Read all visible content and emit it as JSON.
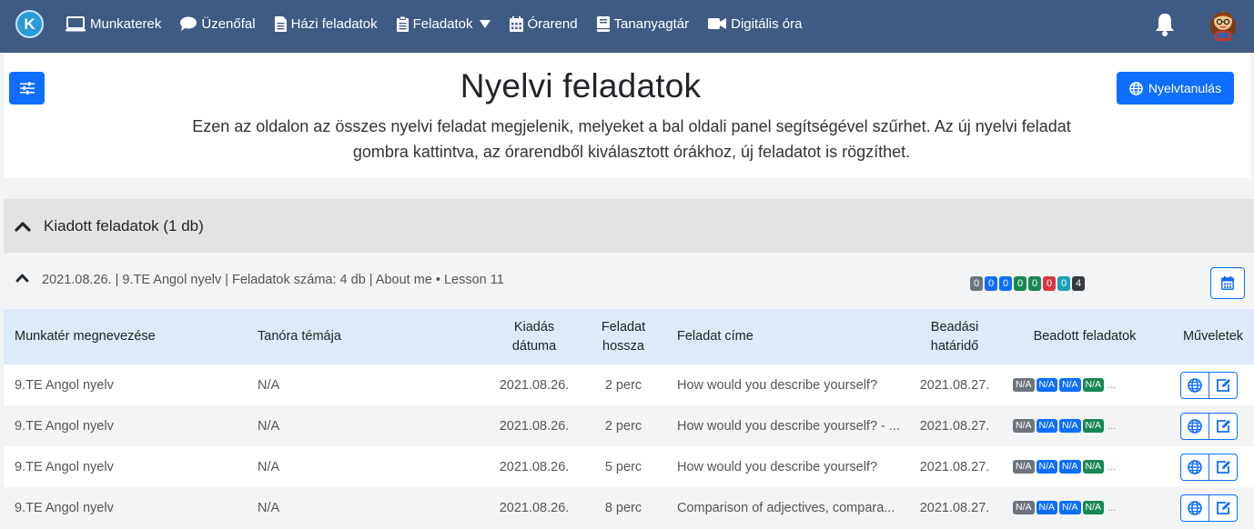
{
  "nav": {
    "logo_letter": "K",
    "items": [
      {
        "label": "Munkaterek",
        "icon": "laptop-icon"
      },
      {
        "label": "Üzenőfal",
        "icon": "chat-icon"
      },
      {
        "label": "Házi feladatok",
        "icon": "file-icon"
      },
      {
        "label": "Feladatok",
        "icon": "clipboard-icon"
      },
      {
        "label": "Órarend",
        "icon": "calendar-icon"
      },
      {
        "label": "Tananyagtár",
        "icon": "book-icon"
      },
      {
        "label": "Digitális óra",
        "icon": "video-icon"
      }
    ]
  },
  "header": {
    "title": "Nyelvi feladatok",
    "language_button": "Nyelvtanulás",
    "description": "Ezen az oldalon az összes nyelvi feladat megjelenik, melyeket a bal oldali panel segítségével szűrhet. Az új nyelvi feladat gombra kattintva, az órarendből kiválasztott órákhoz, új feladatot is rögzíthet."
  },
  "section": {
    "title": "Kiadott feladatok (1 db)"
  },
  "group": {
    "summary": "2021.08.26. | 9.TE Angol nyelv | Feladatok száma: 4 db | About me • Lesson 11",
    "counts": [
      {
        "value": "0",
        "color": "#6c757d"
      },
      {
        "value": "0",
        "color": "#0d6efd"
      },
      {
        "value": "0",
        "color": "#0d6efd"
      },
      {
        "value": "0",
        "color": "#198754"
      },
      {
        "value": "0",
        "color": "#198754"
      },
      {
        "value": "0",
        "color": "#dc3545"
      },
      {
        "value": "0",
        "color": "#17a2b8"
      },
      {
        "value": "4",
        "color": "#343a40"
      }
    ]
  },
  "table": {
    "headers": {
      "workspace": "Munkatér megnevezése",
      "topic": "Tanóra témája",
      "issued_l1": "Kiadás",
      "issued_l2": "dátuma",
      "length_l1": "Feladat",
      "length_l2": "hossza",
      "task_title": "Feladat címe",
      "deadline_l1": "Beadási",
      "deadline_l2": "határidő",
      "submitted": "Beadott feladatok",
      "actions": "Műveletek"
    },
    "rows": [
      {
        "workspace": "9.TE Angol nyelv",
        "topic": "N/A",
        "issued": "2021.08.26.",
        "length": "2 perc",
        "title": "How would you describe yourself?",
        "deadline": "2021.08.27.",
        "badges": [
          "N/A",
          "N/A",
          "N/A",
          "N/A"
        ],
        "more": "..."
      },
      {
        "workspace": "9.TE Angol nyelv",
        "topic": "N/A",
        "issued": "2021.08.26.",
        "length": "2 perc",
        "title": "How would you describe yourself? - ...",
        "deadline": "2021.08.27.",
        "badges": [
          "N/A",
          "N/A",
          "N/A",
          "N/A"
        ],
        "more": "..."
      },
      {
        "workspace": "9.TE Angol nyelv",
        "topic": "N/A",
        "issued": "2021.08.26.",
        "length": "5 perc",
        "title": "How would you describe yourself?",
        "deadline": "2021.08.27.",
        "badges": [
          "N/A",
          "N/A",
          "N/A",
          "N/A"
        ],
        "more": "..."
      },
      {
        "workspace": "9.TE Angol nyelv",
        "topic": "N/A",
        "issued": "2021.08.26.",
        "length": "8 perc",
        "title": "Comparison of adjectives, compara...",
        "deadline": "2021.08.27.",
        "badges": [
          "N/A",
          "N/A",
          "N/A",
          "N/A"
        ],
        "more": "..."
      }
    ]
  },
  "colors": {
    "navbar": "#3f5b85",
    "primary": "#0d6efd",
    "table_header": "#ddeaf9"
  }
}
